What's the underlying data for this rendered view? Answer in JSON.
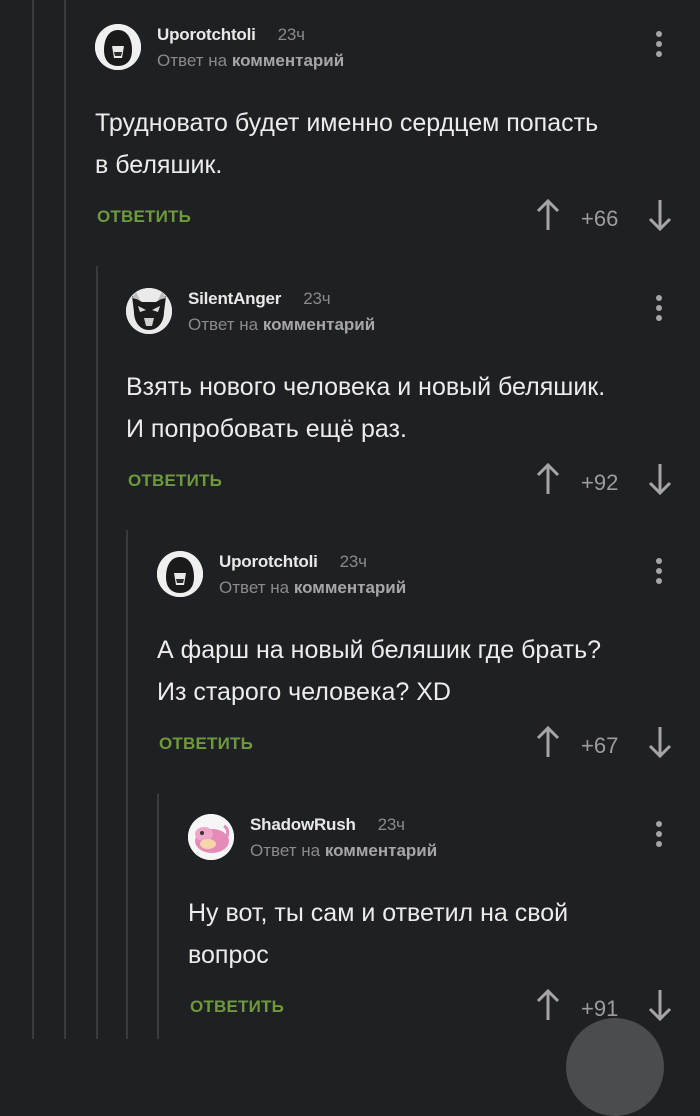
{
  "comments": [
    {
      "author": "Uporotchtoli",
      "time": "23ч",
      "reply_prefix": "Ответ на",
      "reply_target": "комментарий",
      "text_line1": "Трудновато будет именно сердцем попасть",
      "text_line2": "в беляшик.",
      "reply_label": "ответить",
      "rating": "+66",
      "avatar_icon": "masked-character-avatar"
    },
    {
      "author": "SilentAnger",
      "time": "23ч",
      "reply_prefix": "Ответ на",
      "reply_target": "комментарий",
      "text_line1": "Взять нового человека и новый беляшик.",
      "text_line2": "И попробовать ещё раз.",
      "reply_label": "ответить",
      "rating": "+92",
      "avatar_icon": "wolf-mask-avatar"
    },
    {
      "author": "Uporotchtoli",
      "time": "23ч",
      "reply_prefix": "Ответ на",
      "reply_target": "комментарий",
      "text_line1": "А фарш на новый беляшик где брать?",
      "text_line2": "Из старого человека? XD",
      "reply_label": "ответить",
      "rating": "+67",
      "avatar_icon": "masked-character-avatar"
    },
    {
      "author": "ShadowRush",
      "time": "23ч",
      "reply_prefix": "Ответ на",
      "reply_target": "комментарий",
      "text_line1": "Ну вот, ты сам и ответил на свой",
      "text_line2": "вопрос",
      "reply_label": "ответить",
      "rating": "+91",
      "avatar_icon": "pink-pokemon-avatar"
    }
  ],
  "colors": {
    "background": "#1f2023",
    "reply_green": "#6d9a3b",
    "muted_text": "#8a8a8e"
  }
}
